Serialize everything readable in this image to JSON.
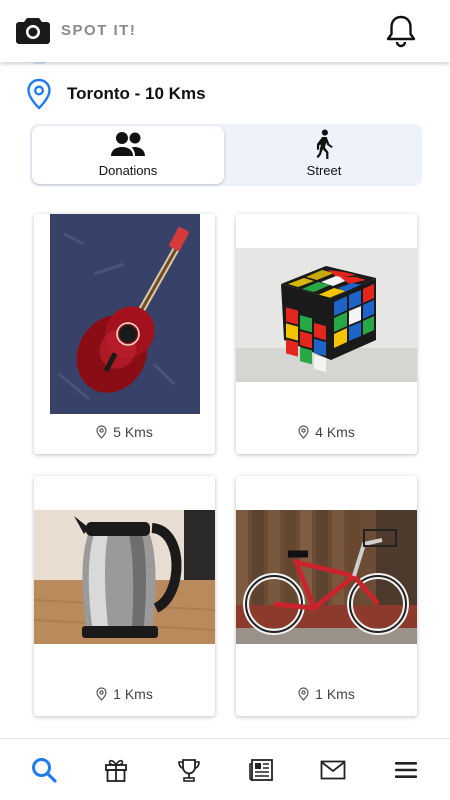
{
  "app": {
    "title": "SPOT IT!"
  },
  "location": {
    "text": "Toronto - 10 Kms"
  },
  "tabs": [
    {
      "label": "Donations",
      "icon": "people-icon",
      "active": true
    },
    {
      "label": "Street",
      "icon": "walking-person-icon",
      "active": false
    }
  ],
  "items": [
    {
      "photo": "acoustic guitar",
      "distance": "5 Kms"
    },
    {
      "photo": "rubiks cube",
      "distance": "4 Kms"
    },
    {
      "photo": "electric kettle",
      "distance": "1 Kms"
    },
    {
      "photo": "red cruiser bicycle",
      "distance": "1 Kms"
    }
  ],
  "bottom_nav": [
    {
      "icon": "search-icon",
      "active": true
    },
    {
      "icon": "gift-icon",
      "active": false
    },
    {
      "icon": "trophy-icon",
      "active": false
    },
    {
      "icon": "newspaper-icon",
      "active": false
    },
    {
      "icon": "mail-icon",
      "active": false
    },
    {
      "icon": "menu-icon",
      "active": false
    }
  ],
  "colors": {
    "accent": "#1f7cf0",
    "tab_bg": "#eef2fb",
    "text_muted": "#8a8a8a"
  }
}
